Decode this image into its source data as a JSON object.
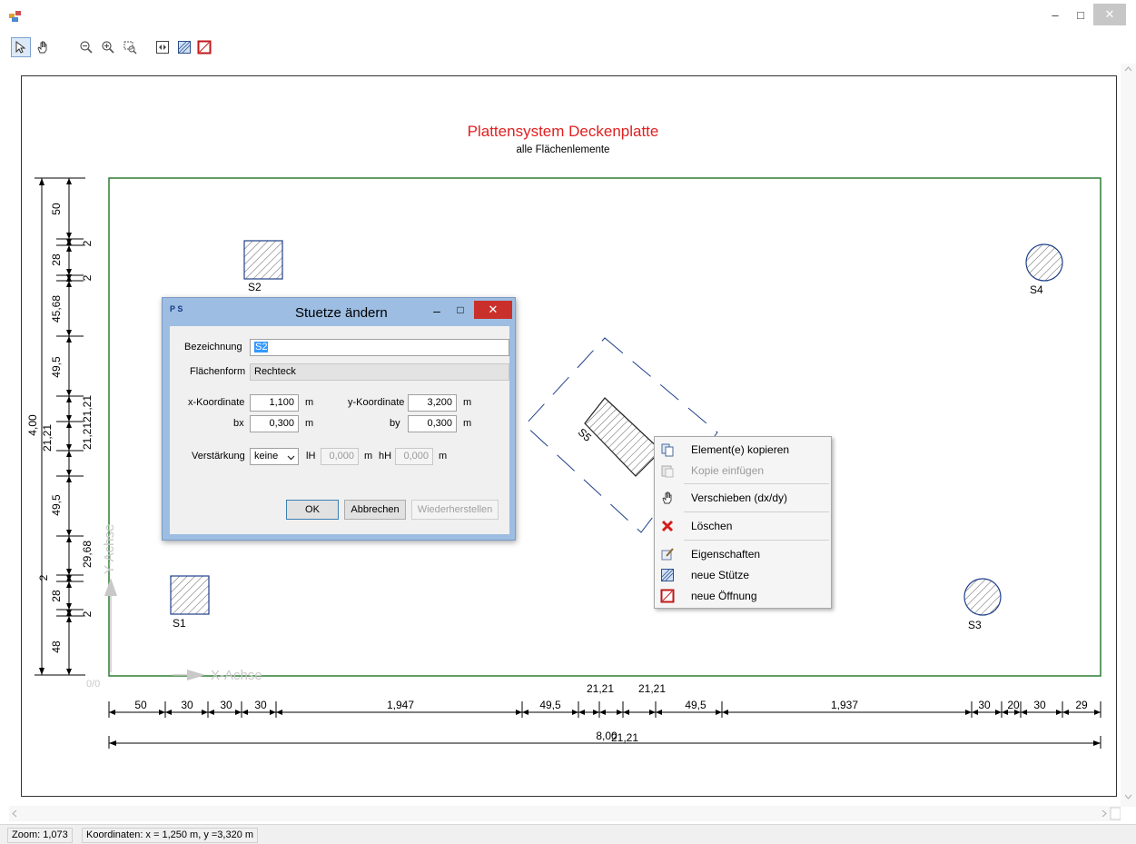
{
  "window": {
    "minimize_symbol": "–",
    "maximize_symbol": "□",
    "close_symbol": "✕"
  },
  "toolbar": {
    "tools": [
      {
        "name": "select-tool",
        "icon": "arrow-cursor-icon"
      },
      {
        "name": "pan-tool",
        "icon": "hand-icon"
      },
      {
        "name": "zoom-out-tool",
        "icon": "zoom-out-icon"
      },
      {
        "name": "zoom-in-tool",
        "icon": "zoom-in-icon"
      },
      {
        "name": "zoom-window-tool",
        "icon": "zoom-window-icon"
      },
      {
        "name": "zoom-fit-tool",
        "icon": "zoom-extents-icon"
      },
      {
        "name": "new-column-tool",
        "icon": "hatched-square-icon"
      },
      {
        "name": "new-opening-tool",
        "icon": "red-opening-icon"
      }
    ]
  },
  "drawing": {
    "title": "Plattensystem Deckenplatte",
    "subtitle": "alle Flächenlemente",
    "title_color": "#e02020",
    "slab_color": "#2e7d32",
    "origin_label": "0/0",
    "x_axis_label": "X-Achse",
    "y_axis_label": "Y-Achse",
    "columns": [
      {
        "label": "S1",
        "shape": "rectangle"
      },
      {
        "label": "S2",
        "shape": "rectangle"
      },
      {
        "label": "S3",
        "shape": "circle"
      },
      {
        "label": "S4",
        "shape": "circle"
      },
      {
        "label": "S5",
        "shape": "rectangle-rotated"
      }
    ],
    "dim_bottom_segments": [
      "50",
      "30",
      "30",
      "30",
      "1,947",
      "49,5",
      "21,21",
      "21,21",
      "49,5",
      "1,937",
      "30",
      "20",
      "30",
      "29"
    ],
    "dim_bottom_total": "8,00",
    "dim_bottom_overlap": "21,21",
    "dim_left_segments": [
      "50",
      "2",
      "28",
      "2",
      "45,68",
      "49,5",
      "21,21",
      "21,21",
      "49,5",
      "29,68",
      "2",
      "28",
      "2",
      "48"
    ],
    "dim_left_total": "4,00",
    "dim_left_overlap": "21,21"
  },
  "dialog": {
    "title": "Stuetze ändern",
    "logo": "P S",
    "minimize_symbol": "–",
    "maximize_symbol": "□",
    "close_symbol": "✕",
    "bezeichnung_label": "Bezeichnung",
    "bezeichnung_value": "S2",
    "flaechenform_label": "Flächenform",
    "flaechenform_value": "Rechteck",
    "x_label": "x-Koordinate",
    "x_value": "1,100",
    "x_unit": "m",
    "y_label": "y-Koordinate",
    "y_value": "3,200",
    "y_unit": "m",
    "bx_label": "bx",
    "bx_value": "0,300",
    "bx_unit": "m",
    "by_label": "by",
    "by_value": "0,300",
    "by_unit": "m",
    "verstaerkung_label": "Verstärkung",
    "verstaerkung_value": "keine",
    "ih_label": "lH",
    "ih_value": "0,000",
    "ih_unit": "m",
    "hh_label": "hH",
    "hh_value": "0,000",
    "hh_unit": "m",
    "ok_label": "OK",
    "cancel_label": "Abbrechen",
    "restore_label": "Wiederherstellen"
  },
  "context_menu": {
    "items": [
      {
        "label": "Element(e) kopieren",
        "icon": "copy-icon",
        "enabled": true
      },
      {
        "label": "Kopie einfügen",
        "icon": "paste-icon",
        "enabled": false
      },
      {
        "label": "Verschieben (dx/dy)",
        "icon": "hand-icon",
        "enabled": true
      },
      {
        "label": "Löschen",
        "icon": "delete-x-icon",
        "enabled": true
      },
      {
        "label": "Eigenschaften",
        "icon": "properties-icon",
        "enabled": true
      },
      {
        "label": "neue Stütze",
        "icon": "hatched-square-icon",
        "enabled": true
      },
      {
        "label": "neue Öffnung",
        "icon": "red-opening-icon",
        "enabled": true
      }
    ]
  },
  "status": {
    "zoom": "Zoom: 1,073",
    "coords": "Koordinaten: x = 1,250 m, y =3,320 m"
  }
}
